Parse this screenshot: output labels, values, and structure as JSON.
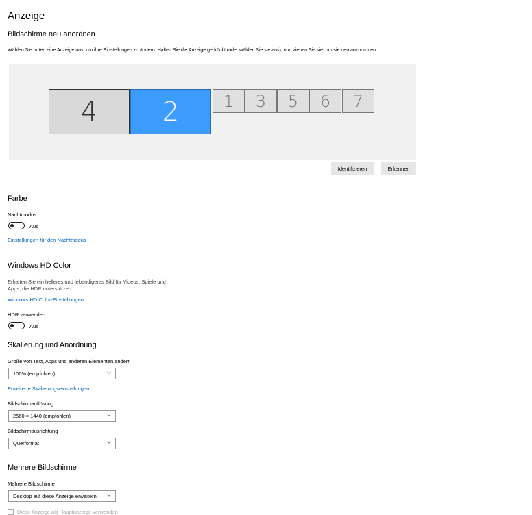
{
  "page": {
    "title": "Anzeige"
  },
  "arrange": {
    "heading": "Bildschirme neu anordnen",
    "description": "Wählen Sie unten eine Anzeige aus, um ihre Einstellungen zu ändern. Halten Sie die Anzeige gedrückt (oder wählen Sie sie aus), und ziehen Sie sie, um sie neu anzuordnen.",
    "monitors": [
      "4",
      "2",
      "1",
      "3",
      "5",
      "6",
      "7"
    ],
    "selected_monitor": "2",
    "identify_label": "Identifizieren",
    "detect_label": "Erkennen"
  },
  "color": {
    "heading": "Farbe",
    "nightmode_label": "Nachtmodus",
    "nightmode_state": "Aus",
    "nightmode_link": "Einstellungen für den Nachtmodus"
  },
  "hdr": {
    "heading": "Windows HD Color",
    "description": "Erhalten Sie ein helleres und lebendigeres Bild für Videos, Spiele und Apps, die HDR unterstützen.",
    "settings_link": "Windows HD Color-Einstellungen",
    "use_hdr_label": "HDR verwenden",
    "use_hdr_state": "Aus"
  },
  "scale": {
    "heading": "Skalierung und Anordnung",
    "size_label": "Größe von Text, Apps und anderen Elementen ändern",
    "size_value": "100% (empfohlen)",
    "advanced_link": "Erweiterte Skalierungseinstellungen",
    "resolution_label": "Bildschirmauflösung",
    "resolution_value": "2560 × 1440 (empfohlen)",
    "orientation_label": "Bildschirmausrichtung",
    "orientation_value": "Querformat"
  },
  "multi": {
    "heading": "Mehrere Bildschirme",
    "label": "Mehrere Bildschirme",
    "value": "Desktop auf diese Anzeige erweitern",
    "main_display_checkbox": "Diese Anzeige als Hauptanzeige verwenden"
  },
  "colors": {
    "accent": "#0067c0",
    "selected_monitor": "#3d9cff",
    "arrange_bg": "#f1f1f1"
  }
}
